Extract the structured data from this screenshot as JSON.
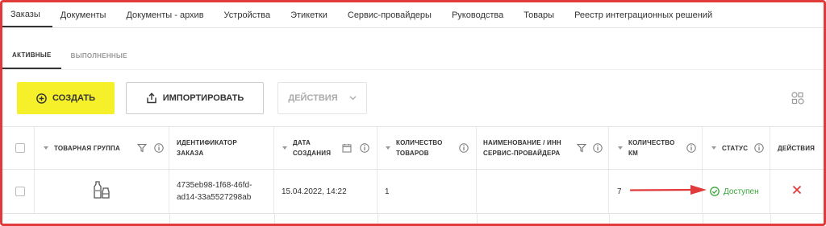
{
  "nav": {
    "tabs": [
      {
        "label": "Заказы",
        "active": true
      },
      {
        "label": "Документы"
      },
      {
        "label": "Документы - архив"
      },
      {
        "label": "Устройства"
      },
      {
        "label": "Этикетки"
      },
      {
        "label": "Сервис-провайдеры"
      },
      {
        "label": "Руководства"
      },
      {
        "label": "Товары"
      },
      {
        "label": "Реестр интеграционных решений"
      }
    ]
  },
  "subtabs": {
    "active": "АКТИВНЫЕ",
    "done": "ВЫПОЛНЕННЫЕ"
  },
  "toolbar": {
    "create_label": "СОЗДАТЬ",
    "import_label": "ИМПОРТИРОВАТЬ",
    "actions_label": "ДЕЙСТВИЯ"
  },
  "table": {
    "headers": {
      "product_group": "ТОВАРНАЯ ГРУППА",
      "order_id_1": "ИДЕНТИФИКАТОР",
      "order_id_2": "ЗАКАЗА",
      "created_1": "ДАТА",
      "created_2": "СОЗДАНИЯ",
      "qty_goods_1": "КОЛИЧЕСТВО",
      "qty_goods_2": "ТОВАРОВ",
      "provider_1": "НАИМЕНОВАНИЕ / ИНН",
      "provider_2": "СЕРВИС-ПРОВАЙДЕРА",
      "qty_km_1": "КОЛИЧЕСТВО",
      "qty_km_2": "КМ",
      "status": "СТАТУС",
      "actions": "ДЕЙСТВИЯ"
    },
    "rows": [
      {
        "product_group_icon": "bottles-icon",
        "order_id_1": "4735eb98-1f68-46fd-",
        "order_id_2": "ad14-33a5527298ab",
        "created": "15.04.2022, 14:22",
        "qty_goods": "1",
        "provider": "",
        "qty_km": "7",
        "status": "Доступен"
      }
    ]
  },
  "colors": {
    "accent_yellow": "#f6f02a",
    "frame_red": "#e03a3a",
    "status_green": "#3aa63a",
    "delete_red": "#e03a3a"
  }
}
